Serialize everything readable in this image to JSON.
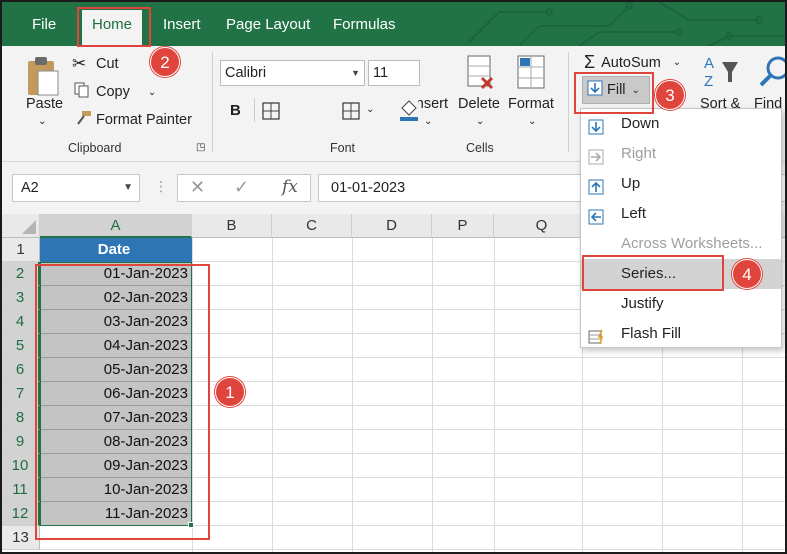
{
  "menu": {
    "tabs": [
      "File",
      "Home",
      "Insert",
      "Page Layout",
      "Formulas"
    ]
  },
  "ribbon": {
    "clipboard": {
      "paste": "Paste",
      "cut": "Cut",
      "copy": "Copy",
      "format_painter": "Format Painter",
      "group_label": "Clipboard"
    },
    "font": {
      "name": "Calibri",
      "size": "11",
      "bold": "B",
      "group_label": "Font"
    },
    "cells": {
      "insert": "Insert",
      "delete": "Delete",
      "format": "Format",
      "group_label": "Cells"
    },
    "editing": {
      "autosum": "AutoSum",
      "fill": "Fill",
      "sort": "Sort &",
      "find": "Find"
    }
  },
  "formula_bar": {
    "name_box": "A2",
    "formula": "01-01-2023",
    "fx": "fx"
  },
  "grid": {
    "columns": [
      "A",
      "B",
      "C",
      "D",
      "P",
      "Q"
    ],
    "rows": [
      "1",
      "2",
      "3",
      "4",
      "5",
      "6",
      "7",
      "8",
      "9",
      "10",
      "11",
      "12",
      "13"
    ],
    "header_cell": "Date",
    "dates": [
      "01-Jan-2023",
      "02-Jan-2023",
      "03-Jan-2023",
      "04-Jan-2023",
      "05-Jan-2023",
      "06-Jan-2023",
      "07-Jan-2023",
      "08-Jan-2023",
      "09-Jan-2023",
      "10-Jan-2023",
      "11-Jan-2023"
    ]
  },
  "fill_menu": {
    "items": [
      {
        "label": "Down",
        "enabled": true
      },
      {
        "label": "Right",
        "enabled": false
      },
      {
        "label": "Up",
        "enabled": true
      },
      {
        "label": "Left",
        "enabled": true
      },
      {
        "label": "Across Worksheets...",
        "enabled": false
      },
      {
        "label": "Series...",
        "enabled": true
      },
      {
        "label": "Justify",
        "enabled": true
      },
      {
        "label": "Flash Fill",
        "enabled": true
      }
    ]
  },
  "annotations": {
    "step1": "1",
    "step2": "2",
    "step3": "3",
    "step4": "4"
  },
  "colors": {
    "excel_green": "#217346",
    "header_blue": "#2e75b6",
    "annotation_red": "#e0453d"
  }
}
